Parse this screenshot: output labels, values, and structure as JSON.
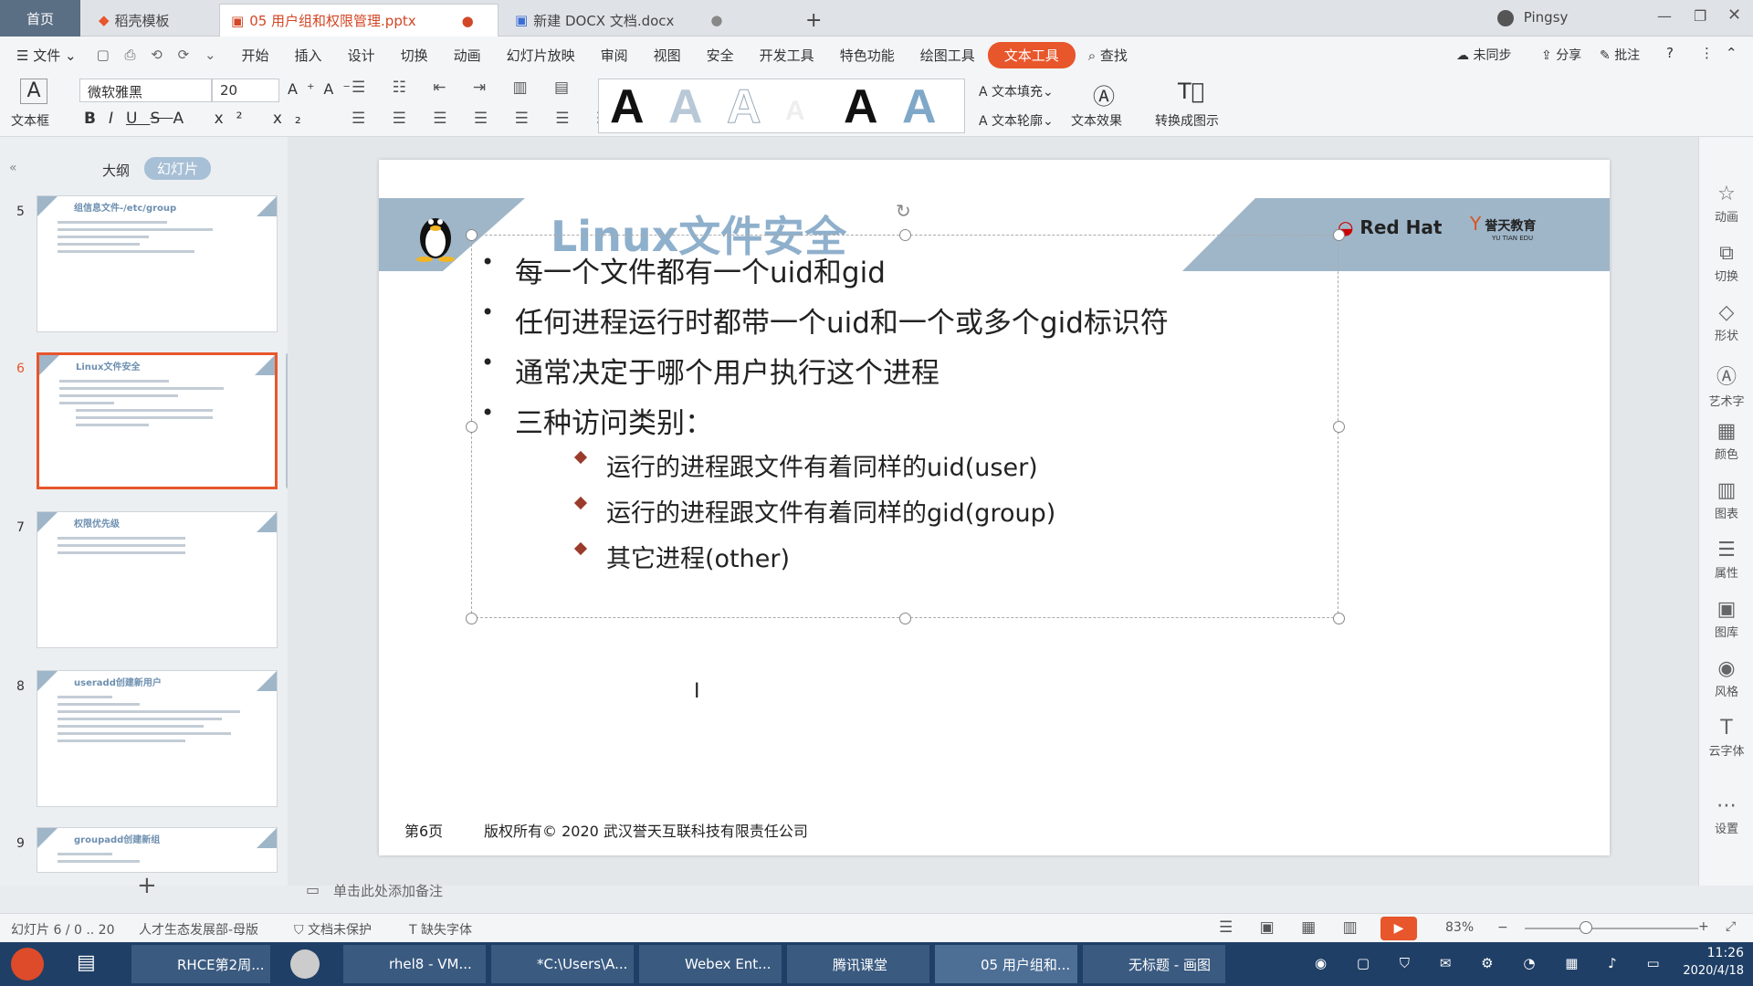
{
  "tabs": {
    "home": "首页",
    "items": [
      {
        "label": "稻壳模板"
      },
      {
        "label": "05 用户组和权限管理.pptx"
      },
      {
        "label": "新建 DOCX 文档.docx"
      }
    ],
    "add": "+",
    "user": "Pingsy"
  },
  "menubar": {
    "file": "文件",
    "items": [
      "开始",
      "插入",
      "设计",
      "切换",
      "动画",
      "幻灯片放映",
      "审阅",
      "视图",
      "安全",
      "开发工具",
      "特色功能",
      "绘图工具",
      "文本工具"
    ],
    "search": "查找",
    "sync": "未同步",
    "share": "分享",
    "comment": "批注"
  },
  "ribbon": {
    "textbox": "文本框",
    "font_name": "微软雅黑",
    "font_size": "20",
    "fill": "文本填充",
    "outline": "文本轮廓",
    "effect": "文本效果",
    "convert": "转换成图示",
    "styles": [
      "A",
      "A",
      "A",
      "A",
      "A",
      "A"
    ]
  },
  "left_panel": {
    "tab_outline": "大纲",
    "tab_slides": "幻灯片",
    "thumbs": [
      {
        "num": "5",
        "title": "组信息文件-/etc/group"
      },
      {
        "num": "6",
        "title": "Linux文件安全"
      },
      {
        "num": "7",
        "title": "权限优先级"
      },
      {
        "num": "8",
        "title": "useradd创建新用户"
      },
      {
        "num": "9",
        "title": "groupadd创建新组"
      }
    ],
    "add": "+"
  },
  "slide": {
    "title": "Linux文件安全",
    "brand": "Red Hat",
    "brand2": "誉天教育",
    "brand3": "YU TIAN EDU",
    "bullets": [
      "每一个文件都有一个uid和gid",
      "任何进程运行时都带一个uid和一个或多个gid标识符",
      "通常决定于哪个用户执行这个进程",
      "三种访问类别："
    ],
    "subbullets": [
      "运行的进程跟文件有着同样的uid(user)",
      "运行的进程跟文件有着同样的gid(group)",
      "其它进程(other)"
    ],
    "page": "第6页",
    "copyright": "版权所有© 2020 武汉誉天互联科技有限责任公司"
  },
  "notes": "单击此处添加备注",
  "right_bar": [
    "动画",
    "切换",
    "形状",
    "艺术字",
    "颜色",
    "图表",
    "属性",
    "图库",
    "风格",
    "云字体",
    "设置"
  ],
  "status": {
    "slide": "幻灯片 6 / 0 .. 20",
    "template": "人才生态发展部-母版",
    "protect": "文档未保护",
    "missing_font": "缺失字体",
    "zoom": "83%"
  },
  "taskbar": {
    "items": [
      "RHCE第2周...",
      "rhel8 - VM...",
      "*C:\\Users\\A...",
      "Webex Ent...",
      "腾讯课堂",
      "05 用户组和...",
      "无标题 - 画图"
    ],
    "time": "11:26",
    "date": "2020/4/18"
  },
  "colors": {
    "accent": "#e8562b",
    "banner": "#9fb6c9",
    "title": "#8fb0cc"
  }
}
